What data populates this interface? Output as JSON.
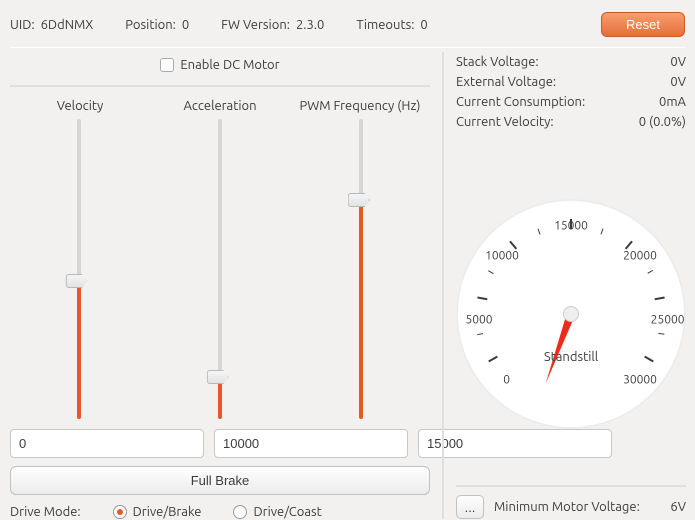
{
  "header": {
    "uid_label": "UID:",
    "uid_value": "6DdNMX",
    "position_label": "Position:",
    "position_value": "0",
    "fw_label": "FW Version:",
    "fw_value": "2.3.0",
    "timeouts_label": "Timeouts:",
    "timeouts_value": "0",
    "reset_label": "Reset"
  },
  "enable": {
    "label": "Enable DC Motor",
    "checked": false
  },
  "sliders": {
    "velocity_label": "Velocity",
    "acceleration_label": "Acceleration",
    "pwm_label": "PWM Frequency (Hz)",
    "velocity_value": "0",
    "acceleration_value": "10000",
    "pwm_value": "15000"
  },
  "full_brake_label": "Full Brake",
  "drive_mode": {
    "label": "Drive Mode:",
    "opt1": "Drive/Brake",
    "opt2": "Drive/Coast",
    "selected": 0
  },
  "status": {
    "stack_voltage_label": "Stack Voltage:",
    "stack_voltage_value": "0V",
    "external_voltage_label": "External Voltage:",
    "external_voltage_value": "0V",
    "current_consumption_label": "Current Consumption:",
    "current_consumption_value": "0mA",
    "current_velocity_label": "Current Velocity:",
    "current_velocity_value": "0 (0.0%)"
  },
  "gauge": {
    "ticks": [
      "0",
      "5000",
      "10000",
      "15000",
      "20000",
      "25000",
      "30000"
    ],
    "center_label": "Standstill"
  },
  "min_voltage": {
    "button_label": "...",
    "label": "Minimum Motor Voltage:",
    "value": "6V"
  }
}
